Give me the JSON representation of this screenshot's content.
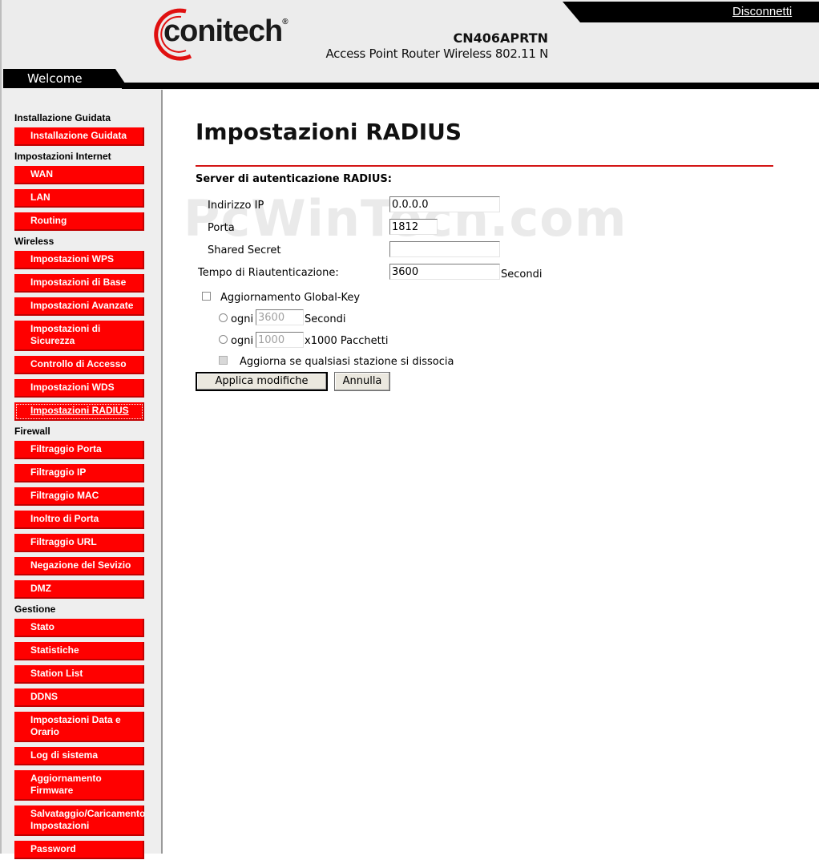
{
  "header": {
    "logo_text": "conitech",
    "logo_reg": "®",
    "model": "CN406APRTN",
    "model_desc": "Access Point Router Wireless 802.11 N",
    "disconnect": "Disconnetti",
    "welcome": "Welcome"
  },
  "sidebar": [
    {
      "section": "Installazione Guidata",
      "items": [
        "Installazione Guidata"
      ]
    },
    {
      "section": "Impostazioni Internet",
      "items": [
        "WAN",
        "LAN",
        "Routing"
      ]
    },
    {
      "section": "Wireless",
      "items": [
        "Impostazioni WPS",
        "Impostazioni di Base",
        "Impostazioni Avanzate",
        "Impostazioni di Sicurezza",
        "Controllo di Accesso",
        "Impostazioni WDS",
        "Impostazioni RADIUS"
      ]
    },
    {
      "section": "Firewall",
      "items": [
        "Filtraggio Porta",
        "Filtraggio IP",
        "Filtraggio MAC",
        "Inoltro di Porta",
        "Filtraggio URL",
        "Negazione del Sevizio",
        "DMZ"
      ]
    },
    {
      "section": "Gestione",
      "items": [
        "Stato",
        "Statistiche",
        "Station List",
        "DDNS",
        "Impostazioni Data e Orario",
        "Log di sistema",
        "Aggiornamento Firmware",
        "Salvataggio/Caricamento Impostazioni",
        "Password"
      ]
    }
  ],
  "active_item": "Impostazioni RADIUS",
  "main": {
    "title": "Impostazioni RADIUS",
    "section": "Server di autenticazione RADIUS:",
    "watermark": "PcWinTech.com",
    "fields": {
      "ip_label": "Indirizzo IP",
      "ip_value": "0.0.0.0",
      "port_label": "Porta",
      "port_value": "1812",
      "secret_label": "Shared Secret",
      "secret_value": "",
      "reauth_label": "Tempo di Riautenticazione:",
      "reauth_value": "3600",
      "reauth_unit": "Secondi"
    },
    "global_key": {
      "label": "Aggiornamento Global-Key",
      "every_label": "ogni",
      "seconds_value": "3600",
      "seconds_unit": "Secondi",
      "packets_value": "1000",
      "packets_unit": "x1000 Pacchetti",
      "dissocia_label": "Aggiorna se qualsiasi stazione si dissocia"
    },
    "buttons": {
      "apply": "Applica modifiche",
      "cancel": "Annulla"
    }
  }
}
